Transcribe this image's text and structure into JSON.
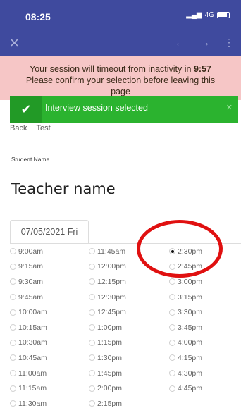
{
  "status": {
    "time": "08:25",
    "network": "4G"
  },
  "nav": {
    "close_icon": "close-icon",
    "back_icon": "arrow-left-icon",
    "forward_icon": "arrow-right-icon",
    "more_icon": "more-vertical-icon"
  },
  "timeout": {
    "line1_prefix": "Your session will timeout from inactivity in ",
    "countdown": "9:57",
    "line2": "Please confirm your selection before leaving this",
    "line3": "page"
  },
  "toast": {
    "message": "Interview session selected",
    "icon": "check-icon"
  },
  "back_row": {
    "back": "Back",
    "test": "Test"
  },
  "student_label": "Student Name",
  "teacher_label": "Teacher name",
  "tab": {
    "label": "07/05/2021 Fri"
  },
  "slots": {
    "col1": [
      "9:00am",
      "9:15am",
      "9:30am",
      "9:45am",
      "10:00am",
      "10:15am",
      "10:30am",
      "10:45am",
      "11:00am",
      "11:15am",
      "11:30am"
    ],
    "col2": [
      "11:45am",
      "12:00pm",
      "12:15pm",
      "12:30pm",
      "12:45pm",
      "1:00pm",
      "1:15pm",
      "1:30pm",
      "1:45pm",
      "2:00pm",
      "2:15pm"
    ],
    "col3": [
      "2:30pm",
      "2:45pm",
      "3:00pm",
      "3:15pm",
      "3:30pm",
      "3:45pm",
      "4:00pm",
      "4:15pm",
      "4:30pm",
      "4:45pm"
    ],
    "selected": "2:30pm"
  },
  "colors": {
    "header": "#3f4a9e",
    "alert": "#f6c6c6",
    "toast": "#2bb32f",
    "annotation": "#e01010"
  }
}
